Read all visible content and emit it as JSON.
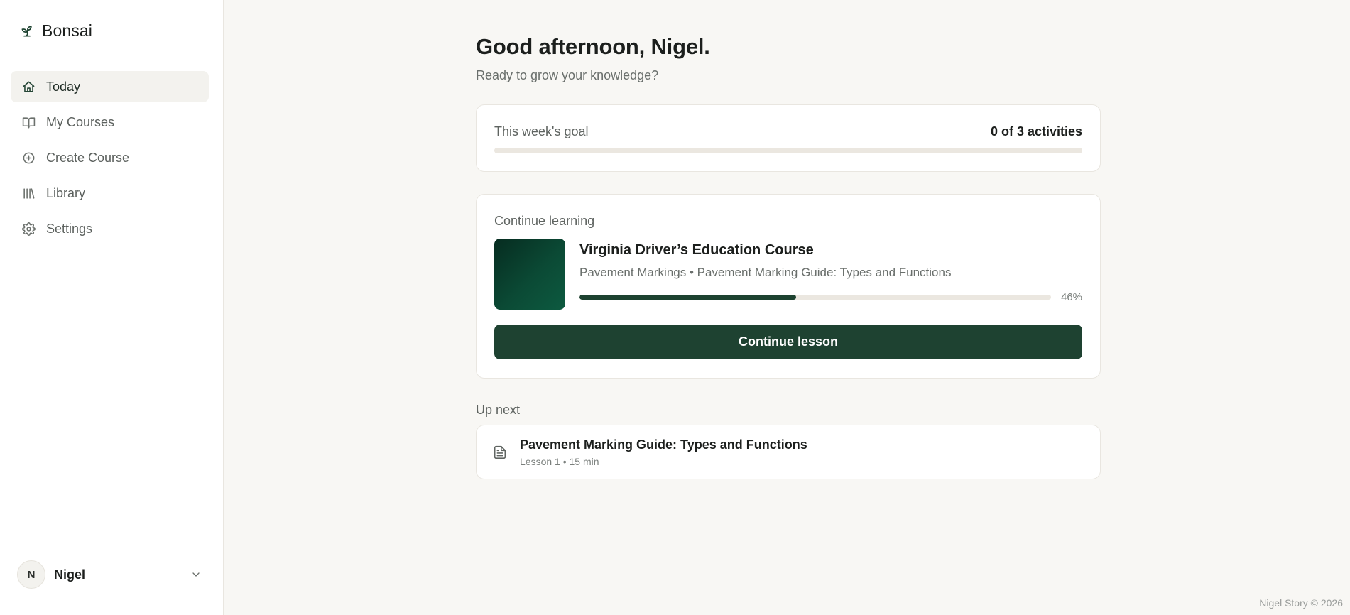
{
  "brand": {
    "name": "Bonsai",
    "icon": "sprout-icon"
  },
  "sidebar": {
    "items": [
      {
        "label": "Today",
        "icon": "home-icon",
        "active": true
      },
      {
        "label": "My Courses",
        "icon": "book-open-icon",
        "active": false
      },
      {
        "label": "Create Course",
        "icon": "plus-circle-icon",
        "active": false
      },
      {
        "label": "Library",
        "icon": "library-icon",
        "active": false
      },
      {
        "label": "Settings",
        "icon": "gear-icon",
        "active": false
      }
    ],
    "user": {
      "initial": "N",
      "name": "Nigel"
    }
  },
  "main": {
    "greeting": "Good afternoon, Nigel.",
    "subtitle": "Ready to grow your knowledge?",
    "goal": {
      "label": "This week's goal",
      "value": "0 of 3 activities",
      "completed": 0,
      "total": 3
    },
    "continue": {
      "section_label": "Continue learning",
      "course_title": "Virginia Driver’s Education Course",
      "course_sub": "Pavement Markings • Pavement Marking Guide: Types and Functions",
      "progress": 46,
      "progress_label": "46%",
      "button_label": "Continue lesson"
    },
    "up_next": {
      "section_label": "Up next",
      "lesson_title": "Pavement Marking Guide: Types and Functions",
      "lesson_meta": "Lesson 1 • 15 min",
      "icon": "document-icon"
    }
  },
  "footer": {
    "text": "Nigel Story © 2026"
  },
  "colors": {
    "accent": "#1e4231",
    "background": "#f8f7f4",
    "track": "#ebe7e0"
  }
}
